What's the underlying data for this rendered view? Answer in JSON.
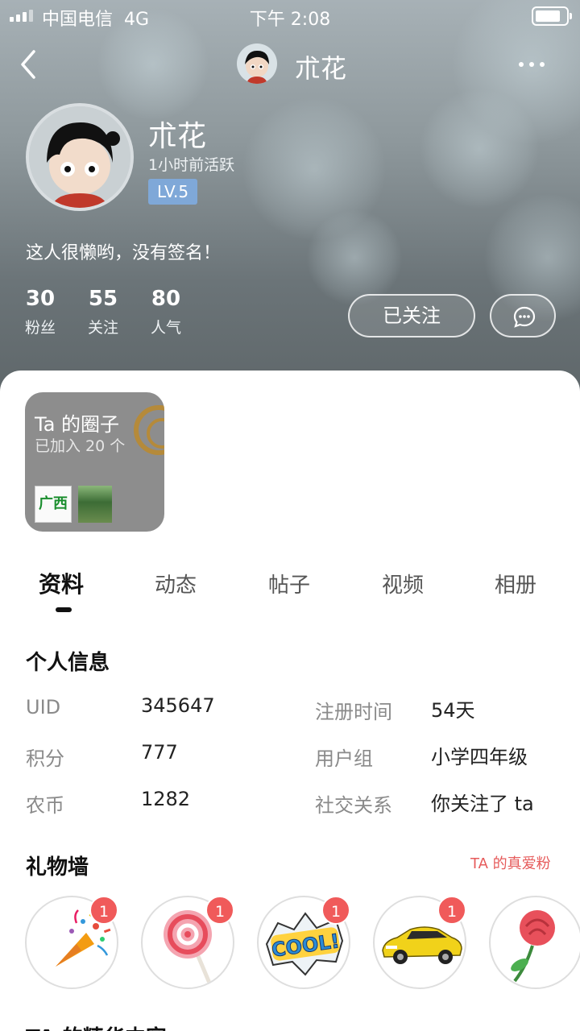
{
  "status_bar": {
    "carrier": "中国电信",
    "network": "4G",
    "time": "下午 2:08"
  },
  "nav": {
    "title": "朮花"
  },
  "profile": {
    "name": "朮花",
    "active_status": "1小时前活跃",
    "level": "LV.5",
    "signature": "这人很懒哟，没有签名！",
    "stats": [
      {
        "value": "30",
        "label": "粉丝"
      },
      {
        "value": "55",
        "label": "关注"
      },
      {
        "value": "80",
        "label": "人气"
      }
    ],
    "follow_label": "已关注"
  },
  "circle_card": {
    "title": "Ta 的圈子",
    "subtitle": "已加入 20 个",
    "thumbs": [
      "广西"
    ]
  },
  "tabs": [
    "资料",
    "动态",
    "帖子",
    "视频",
    "相册"
  ],
  "personal_info": {
    "title": "个人信息",
    "left": [
      {
        "label": "UID",
        "value": "345647"
      },
      {
        "label": "积分",
        "value": "777"
      },
      {
        "label": "农币",
        "value": "1282"
      }
    ],
    "right": [
      {
        "label": "注册时间",
        "value": "54天"
      },
      {
        "label": "用户组",
        "value": "小学四年级"
      },
      {
        "label": "社交关系",
        "value": "你关注了 ta"
      }
    ]
  },
  "gift_wall": {
    "title": "礼物墙",
    "link": "TA 的真爱粉",
    "gifts": [
      {
        "icon": "party-popper-icon",
        "count": "1"
      },
      {
        "icon": "lollipop-icon",
        "count": "1"
      },
      {
        "icon": "cool-sticker-icon",
        "count": "1"
      },
      {
        "icon": "sports-car-icon",
        "count": "1"
      },
      {
        "icon": "rose-icon",
        "count": ""
      }
    ]
  },
  "next_section": "TA 的精华内容",
  "colors": {
    "level_badge": "#7fa8d8",
    "gift_badge": "#f05a5a",
    "fans_link": "#e65b5b"
  }
}
